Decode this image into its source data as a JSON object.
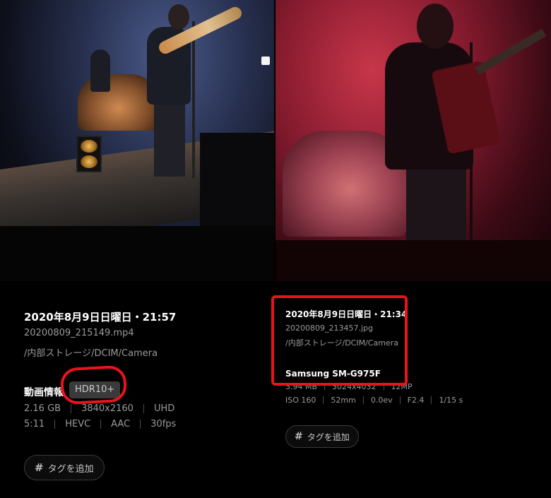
{
  "left": {
    "date": "2020年8月9日日曜日・21:57",
    "filename": "20200809_215149.mp4",
    "path": "/内部ストレージ/DCIM/Camera",
    "section_label": "動画情報",
    "badge": "HDR10+",
    "row1": [
      "2.16 GB",
      "3840x2160",
      "UHD"
    ],
    "row2": [
      "5:11",
      "HEVC",
      "AAC",
      "30fps"
    ],
    "tag_button": "タグを追加"
  },
  "right": {
    "date": "2020年8月9日日曜日・21:34",
    "filename": "20200809_213457.jpg",
    "path": "/内部ストレージ/DCIM/Camera",
    "model": "Samsung SM-G975F",
    "row1": [
      "3.94 MB",
      "3024x4032",
      "12MP"
    ],
    "row2": [
      "ISO 160",
      "52mm",
      "0.0ev",
      "F2.4",
      "1/15 s"
    ],
    "tag_button": "タグを追加"
  },
  "icons": {
    "tag": "hash-icon"
  },
  "colors": {
    "annotation": "#e8141c",
    "badge_bg": "#3a3a3a",
    "secondary_text": "#9a9a9a"
  }
}
